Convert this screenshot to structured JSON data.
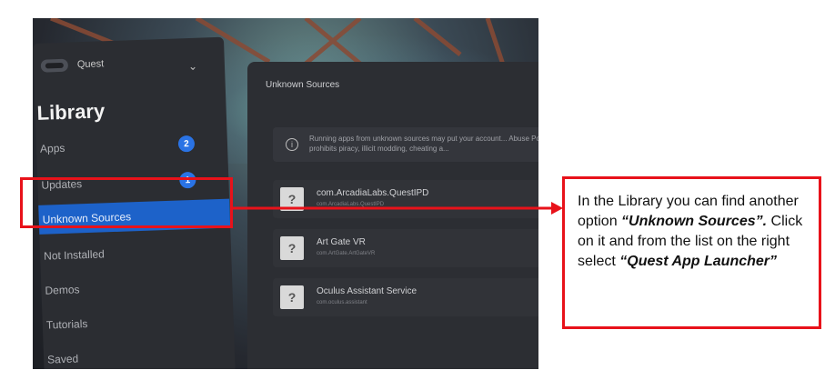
{
  "left_panel": {
    "device_name": "Quest",
    "title": "Library",
    "items": [
      {
        "label": "Apps",
        "badge": "2"
      },
      {
        "label": "Updates",
        "badge": "1"
      },
      {
        "label": "Unknown Sources"
      },
      {
        "label": "Not Installed"
      },
      {
        "label": "Demos"
      },
      {
        "label": "Tutorials"
      },
      {
        "label": "Saved"
      }
    ]
  },
  "right_panel": {
    "title": "Unknown Sources",
    "warning": "Running apps from unknown sources may put your account... Abuse Policy also prohibits piracy, illicit modding, cheating a...",
    "apps": [
      {
        "name": "com.ArcadiaLabs.QuestIPD",
        "package": "com.ArcadiaLabs.QuestIPD"
      },
      {
        "name": "Art Gate VR",
        "package": "com.ArtGate.ArtGateVR"
      },
      {
        "name": "Oculus Assistant Service",
        "package": "com.oculus.assistant"
      }
    ]
  },
  "callout": {
    "line1": "In the Library you can find another option ",
    "em1": "“Unknown Sources”.",
    "line2": " Click on it and from the list on the right select ",
    "em2": "“Quest App Launcher”"
  },
  "colors": {
    "accent_blue": "#1d62c9",
    "annotation_red": "#e8121a",
    "panel_dark": "#2b2d32"
  }
}
